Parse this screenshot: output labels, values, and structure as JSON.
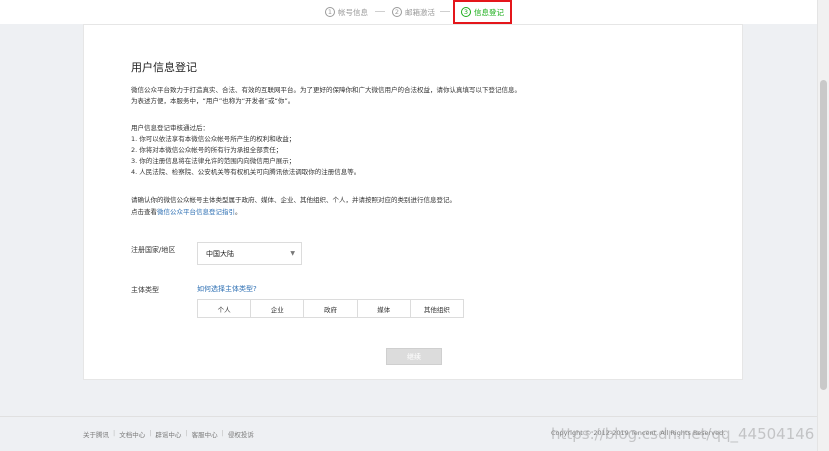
{
  "steps": [
    {
      "num": "1",
      "label": "帐号信息"
    },
    {
      "num": "2",
      "label": "邮箱激活"
    },
    {
      "num": "3",
      "label": "信息登记"
    }
  ],
  "page_title": "用户信息登记",
  "intro": {
    "line1": "微信公众平台致力于打造真实、合法、有效的互联网平台。为了更好的保障你和广大微信用户的合法权益，请你认真填写以下登记信息。",
    "line2": "为表述方便，本服务中，“用户”也称为“开发者”或“你”。"
  },
  "after_review": {
    "heading": "用户信息登记审核通过后：",
    "items": [
      "1. 你可以依法享有本微信公众帐号所产生的权利和收益；",
      "2. 你将对本微信公众帐号的所有行为承担全部责任；",
      "3. 你的注册信息将在法律允许的范围内向微信用户展示；",
      "4. 人民法院、检察院、公安机关等有权机关可向腾讯依法调取你的注册信息等。"
    ]
  },
  "confirm": {
    "line1": "请确认你的微信公众帐号主体类型属于政府、媒体、企业、其他组织、个人，并请按照对应的类别进行信息登记。",
    "line2_prefix": "点击查看",
    "guide_link": "微信公众平台信息登记指引",
    "line2_suffix": "。"
  },
  "region": {
    "label": "注册国家/地区",
    "value": "中国大陆"
  },
  "subject_type": {
    "label": "主体类型",
    "help_link": "如何选择主体类型?",
    "options": [
      "个人",
      "企业",
      "政府",
      "媒体",
      "其他组织"
    ]
  },
  "continue_label": "继续",
  "footer": {
    "links": [
      "关于腾讯",
      "文档中心",
      "辟谣中心",
      "客服中心",
      "侵权投诉"
    ],
    "copyright": "Copyright © 2012-2019 Tencent. All Rights Reserved.",
    "watermark": "https://blog.csdn.net/qq_44504146"
  },
  "colors": {
    "accent": "#1aad19",
    "highlight_border": "#e4161b",
    "link": "#2d6fb3",
    "disabled_button": "#dcdcdc"
  }
}
